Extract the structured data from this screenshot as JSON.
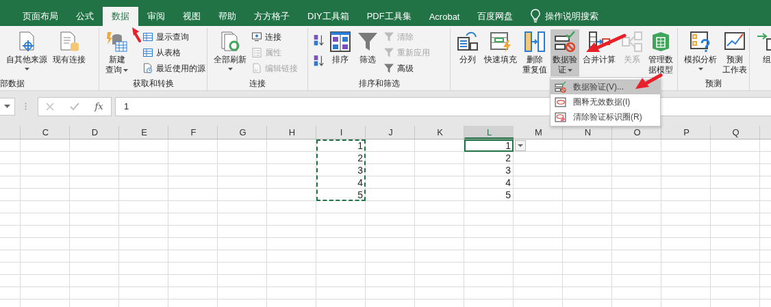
{
  "tabs": [
    {
      "label": "页面布局",
      "selected": false
    },
    {
      "label": "公式",
      "selected": false
    },
    {
      "label": "数据",
      "selected": true
    },
    {
      "label": "审阅",
      "selected": false
    },
    {
      "label": "视图",
      "selected": false
    },
    {
      "label": "帮助",
      "selected": false
    },
    {
      "label": "方方格子",
      "selected": false
    },
    {
      "label": "DIY工具箱",
      "selected": false
    },
    {
      "label": "PDF工具集",
      "selected": false
    },
    {
      "label": "Acrobat",
      "selected": false
    },
    {
      "label": "百度网盘",
      "selected": false
    }
  ],
  "tell_me": {
    "label": "操作说明搜索"
  },
  "ribbon": {
    "groups": [
      {
        "label": "部数据",
        "items": [
          {
            "kind": "large",
            "lines": [
              "自其他来源"
            ],
            "menu": true,
            "disabled": false,
            "open": false
          },
          {
            "kind": "large",
            "lines": [
              "现有连接"
            ],
            "menu": false,
            "disabled": false,
            "open": false
          }
        ]
      },
      {
        "label": "获取和转换",
        "items": [
          {
            "kind": "large",
            "lines": [
              "新建",
              "查询"
            ],
            "menu": true,
            "disabled": false,
            "open": false
          },
          {
            "kind": "small",
            "lines": [
              "显示查询"
            ],
            "disabled": false
          },
          {
            "kind": "small",
            "lines": [
              "从表格"
            ],
            "disabled": false
          },
          {
            "kind": "small",
            "lines": [
              "最近使用的源"
            ],
            "disabled": false
          }
        ]
      },
      {
        "label": "连接",
        "items": [
          {
            "kind": "large",
            "lines": [
              "全部刷新"
            ],
            "menu": true,
            "disabled": false,
            "open": false
          },
          {
            "kind": "small",
            "lines": [
              "连接"
            ],
            "disabled": false
          },
          {
            "kind": "small",
            "lines": [
              "属性"
            ],
            "disabled": true
          },
          {
            "kind": "small",
            "lines": [
              "编辑链接"
            ],
            "disabled": true
          }
        ]
      },
      {
        "label": "排序和筛选",
        "items": [
          {
            "kind": "icon",
            "disabled": false
          },
          {
            "kind": "icon",
            "disabled": false
          },
          {
            "kind": "large",
            "lines": [
              "排序"
            ],
            "menu": false,
            "disabled": false,
            "open": false
          },
          {
            "kind": "large",
            "lines": [
              "筛选"
            ],
            "menu": false,
            "disabled": false,
            "open": false
          },
          {
            "kind": "small",
            "lines": [
              "清除"
            ],
            "disabled": true
          },
          {
            "kind": "small",
            "lines": [
              "重新应用"
            ],
            "disabled": true
          },
          {
            "kind": "small",
            "lines": [
              "高级"
            ],
            "disabled": false
          }
        ]
      },
      {
        "items": [
          {
            "kind": "large",
            "lines": [
              "分列"
            ],
            "menu": false,
            "disabled": false,
            "open": false
          },
          {
            "kind": "large",
            "lines": [
              "快速填充"
            ],
            "menu": false,
            "disabled": false,
            "open": false
          },
          {
            "kind": "large",
            "lines": [
              "删除",
              "重复值"
            ],
            "menu": false,
            "disabled": false,
            "open": false
          },
          {
            "kind": "large",
            "lines": [
              "数据验",
              "证"
            ],
            "menu": true,
            "disabled": false,
            "open": true
          },
          {
            "kind": "large",
            "lines": [
              "合并计算"
            ],
            "menu": false,
            "disabled": false,
            "open": false
          },
          {
            "kind": "large",
            "lines": [
              "关系"
            ],
            "menu": false,
            "disabled": true,
            "open": false
          },
          {
            "kind": "large",
            "lines": [
              "管理数",
              "据模型"
            ],
            "menu": false,
            "disabled": false,
            "open": false
          }
        ]
      },
      {
        "label": "预测",
        "items": [
          {
            "kind": "large",
            "lines": [
              "模拟分析"
            ],
            "menu": true,
            "disabled": false,
            "open": false
          },
          {
            "kind": "large",
            "lines": [
              "预测",
              "工作表"
            ],
            "menu": false,
            "disabled": false,
            "open": false
          }
        ]
      },
      {
        "items": [
          {
            "kind": "large",
            "lines": [
              "组"
            ],
            "menu": false,
            "disabled": false,
            "open": false
          }
        ]
      }
    ]
  },
  "data_validation_menu": {
    "items": [
      {
        "label": "数据验证(V)...",
        "highlighted": true
      },
      {
        "label": "圈释无效数据(I)",
        "highlighted": false
      },
      {
        "label": "清除验证标识圈(R)",
        "highlighted": false
      }
    ]
  },
  "formula_bar": {
    "function_label": "fx",
    "value": "1"
  },
  "sheet": {
    "columns": [
      {
        "label": "C",
        "selected": false,
        "copied": false
      },
      {
        "label": "D",
        "selected": false,
        "copied": false
      },
      {
        "label": "E",
        "selected": false,
        "copied": false
      },
      {
        "label": "F",
        "selected": false,
        "copied": false
      },
      {
        "label": "G",
        "selected": false,
        "copied": false
      },
      {
        "label": "H",
        "selected": false,
        "copied": false
      },
      {
        "label": "I",
        "selected": false,
        "copied": true
      },
      {
        "label": "J",
        "selected": false,
        "copied": false
      },
      {
        "label": "K",
        "selected": false,
        "copied": false
      },
      {
        "label": "L",
        "selected": true,
        "copied": false
      },
      {
        "label": "M",
        "selected": false,
        "copied": false
      },
      {
        "label": "N",
        "selected": false,
        "copied": false
      },
      {
        "label": "O",
        "selected": false,
        "copied": false
      },
      {
        "label": "P",
        "selected": false,
        "copied": false
      },
      {
        "label": "Q",
        "selected": false,
        "copied": false
      }
    ],
    "rows": [
      {
        "selected": true,
        "cells": {
          "I": "1",
          "L": "1"
        }
      },
      {
        "selected": false,
        "cells": {
          "I": "2",
          "L": "2"
        }
      },
      {
        "selected": false,
        "cells": {
          "I": "3",
          "L": "3"
        }
      },
      {
        "selected": false,
        "cells": {
          "I": "4",
          "L": "4"
        }
      },
      {
        "selected": false,
        "cells": {
          "I": "5",
          "L": "5"
        }
      }
    ],
    "list_dropdown": true
  }
}
